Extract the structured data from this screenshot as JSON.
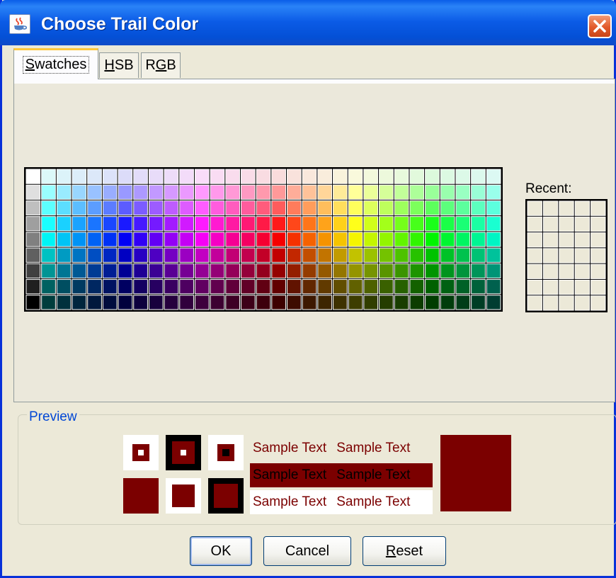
{
  "window": {
    "title": "Choose Trail Color",
    "icon": "java-cup-icon",
    "close_icon": "close-icon"
  },
  "tabs": [
    {
      "label": "Swatches",
      "mnemonic": "S",
      "active": true
    },
    {
      "label": "HSB",
      "mnemonic": "H",
      "active": false
    },
    {
      "label": "RGB",
      "mnemonic": "G",
      "active": false
    }
  ],
  "swatches": {
    "columns": 31,
    "rows": 9,
    "selected_index": 0,
    "recent_label": "Recent:",
    "recent_columns": 5,
    "recent_rows": 7
  },
  "preview": {
    "title": "Preview",
    "color": "#7b0000",
    "sample_text": "Sample Text",
    "row_bg_highlight": "#7b0000",
    "row_text_highlight": "#000000"
  },
  "buttons": {
    "ok": "OK",
    "cancel": "Cancel",
    "reset": "Reset",
    "reset_mnemonic": "R"
  },
  "colors": {
    "dialog_bg": "#ece9d8",
    "title_blue": "#0b5be6",
    "accent": "#0046d5"
  }
}
